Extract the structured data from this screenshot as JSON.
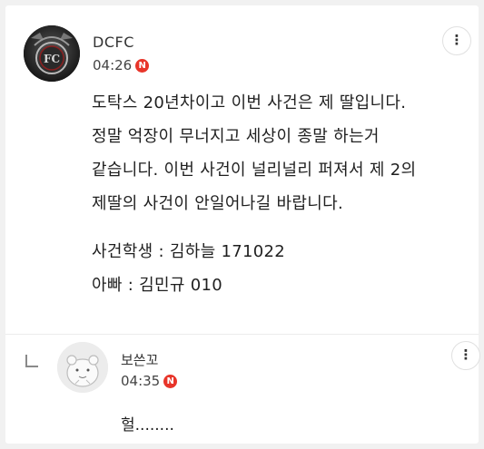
{
  "post": {
    "author": "DCFC",
    "time": "04:26",
    "new_badge": "N",
    "avatar_logo_text": "FC",
    "lines": [
      "도탁스 20년차이고 이번 사건은 제 딸입니다.",
      "정말 억장이 무너지고 세상이 종말 하는거",
      "같습니다. 이번 사건이 널리널리 퍼져서 제 2의",
      "제딸의 사건이 안일어나길 바랍니다."
    ],
    "student_line": "사건학생 : 김하늘 171022",
    "father_line": "아빠 : 김민규 010"
  },
  "reply": {
    "author": "보쓴꼬",
    "time": "04:35",
    "new_badge": "N",
    "text": "헐........"
  },
  "icons": {
    "more": "more-vertical-icon",
    "reply_arrow": "reply-arrow-icon",
    "new_badge_color": "#e8352a"
  }
}
